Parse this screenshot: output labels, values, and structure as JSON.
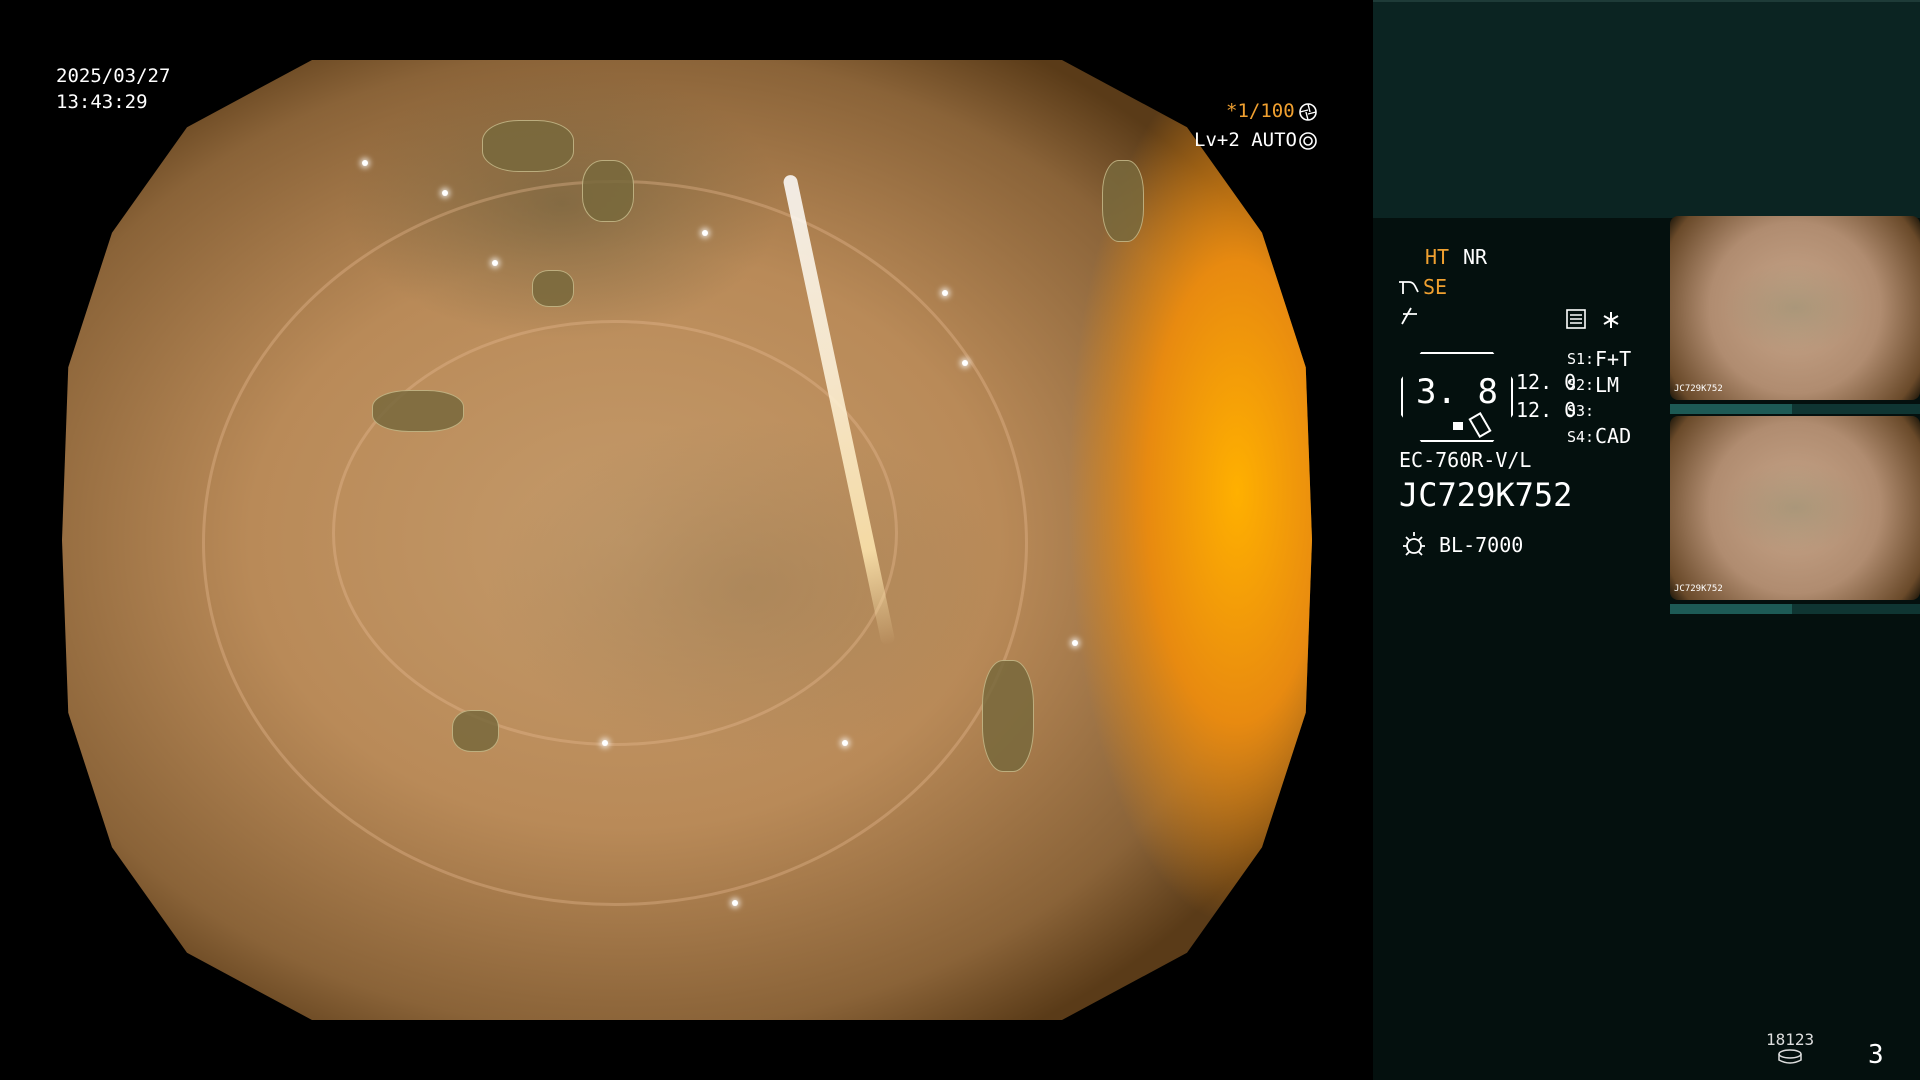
{
  "overlay": {
    "date": "2025/03/27",
    "time": "13:43:29",
    "shutter": "*1/100",
    "level": "Lv+2 AUTO"
  },
  "panel": {
    "mode_ht": "HT",
    "mode_nr": "NR",
    "mode_se": "SE",
    "severity": "3. 8",
    "val_top": "12. 0",
    "val_bottom": "12. 0",
    "s1": "S1:",
    "s1_val": "F+T",
    "s2": "S2:",
    "s2_val": "LM",
    "s3": "S3:",
    "s4": "S4:",
    "s4_val": "CAD",
    "scope_model": "EC-760R-V/L",
    "scope_serial": "JC729K752",
    "light_source": "BL-7000",
    "thumb_label_1": "JC729K752",
    "thumb_label_2": "JC729K752",
    "counter": "18123",
    "page": "3"
  },
  "icons": [
    "aperture-icon",
    "iris-icon",
    "scope-bend-icon",
    "signal-icon",
    "settings-panel-icon",
    "asterisk-icon",
    "lamp-icon",
    "storage-icon"
  ],
  "colors": {
    "accent": "#f0a030",
    "panel_bg": "#04100e",
    "panel_top": "#0b2422"
  }
}
